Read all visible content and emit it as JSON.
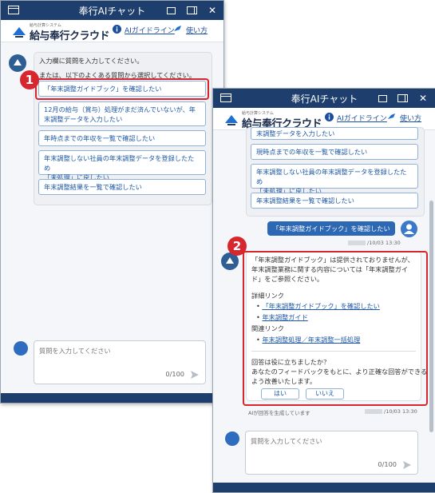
{
  "window": {
    "title": "奉行AIチャット",
    "brand_sub": "給与計算システム",
    "brand_name": "給与奉行クラウド",
    "link_guideline": "AIガイドライン",
    "link_howto": "使い方"
  },
  "window1": {
    "bot_message_line1": "入力欄に質問を入力してください。",
    "bot_message_line2": "または、以下のよくある質問から選択してください。",
    "faq": [
      {
        "line1": "「年末調整ガイドブック」を確認したい",
        "line2": ""
      },
      {
        "line1": "12月の給与（賞与）処理がまだ済んでいないが、年",
        "line2": "末調整データを入力したい"
      },
      {
        "line1": "年時点までの年収を一覧で確認したい",
        "line2": ""
      },
      {
        "line1": "年末調整しない社員の年末調整データを登録したため",
        "line2": "「未処理」に戻したい"
      },
      {
        "line1": "年末調整結果を一覧で確認したい",
        "line2": ""
      }
    ],
    "input_placeholder": "質問を入力してください",
    "char_count": "0/100",
    "badge": "1"
  },
  "window2": {
    "faq_visible": [
      {
        "line1": "末調整データを入力したい",
        "line2": ""
      },
      {
        "line1": "現時点までの年収を一覧で確認したい",
        "line2": ""
      },
      {
        "line1": "年末調整しない社員の年末調整データを登録したため",
        "line2": "「未処理」に戻したい"
      },
      {
        "line1": "年末調整結果を一覧で確認したい",
        "line2": ""
      }
    ],
    "user_message": "「年末調整ガイドブック」を確認したい",
    "user_timestamp": "/10/03 13:30",
    "answer": {
      "line1": "「年末調整ガイドブック」は提供されておりませんが、",
      "line2": "年末調整業務に関する内容については「年末調整ガイ",
      "line3": "ド」をご参照ください。",
      "detail_heading": "詳細リンク",
      "detail_links": [
        "「年末調整ガイドブック」を確認したい",
        "年末調整ガイド"
      ],
      "related_heading": "関連リンク",
      "related_links": [
        "年末調整処理／年末調整一括処理"
      ],
      "feedback_q": "回答は役に立ちましたか？",
      "feedback_l2": "あなたのフィードバックをもとに、より正確な回答ができる",
      "feedback_l3": "よう改善いたします。",
      "yes": "はい",
      "no": "いいえ"
    },
    "ai_note": "AIが回答を生成しています",
    "bot_timestamp": "/10/03 13:30",
    "input_placeholder": "質問を入力してください",
    "char_count": "0/100",
    "badge": "2"
  },
  "colors": {
    "accent": "#1e3f6e",
    "link": "#1c57a5",
    "highlight": "#d8262f"
  }
}
